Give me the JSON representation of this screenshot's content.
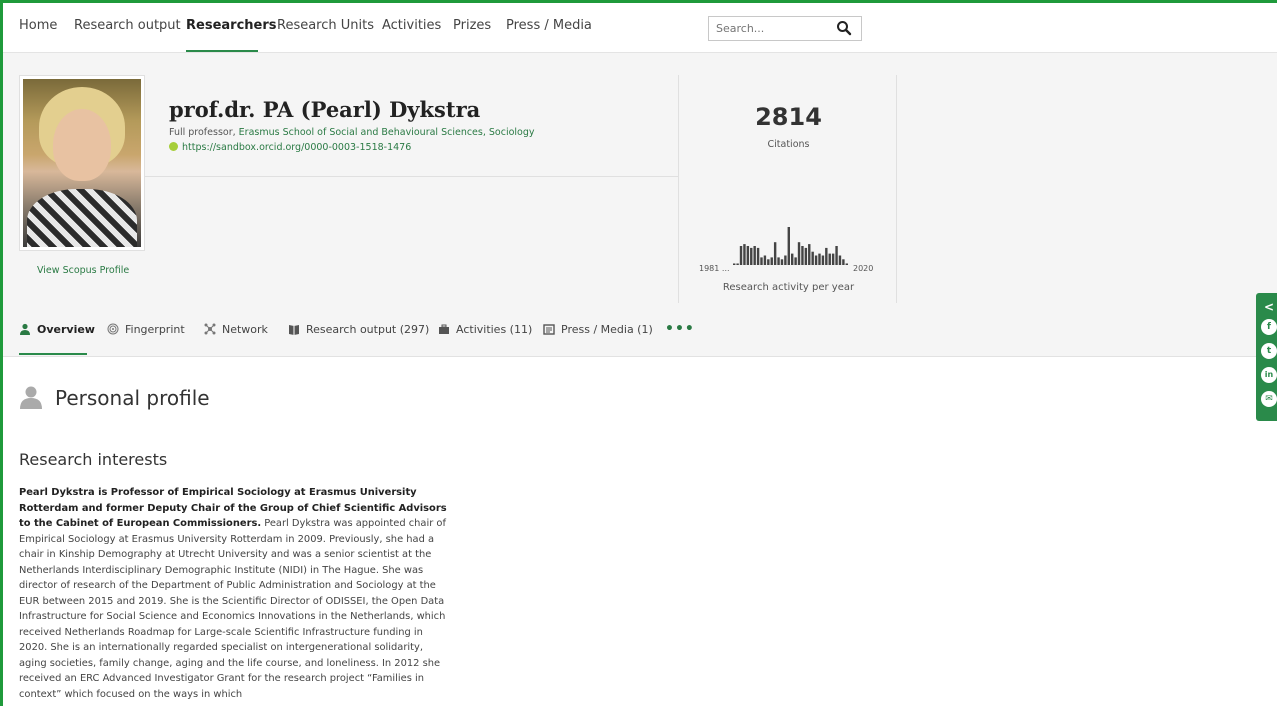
{
  "nav": {
    "items": [
      "Home",
      "Research output",
      "Researchers",
      "Research Units",
      "Activities",
      "Prizes",
      "Press / Media"
    ],
    "active_index": 2,
    "search_placeholder": "Search..."
  },
  "profile": {
    "name": "prof.dr. PA (Pearl) Dykstra",
    "position_prefix": "Full professor, ",
    "position_link": "Erasmus School of Social and Behavioural Sciences, Sociology",
    "orcid": "https://sandbox.orcid.org/0000-0003-1518-1476",
    "scopus_link": "View Scopus Profile"
  },
  "stats": {
    "citations": "2814",
    "citations_label": "Citations",
    "activity_start": "1981 ...",
    "activity_end": "2020",
    "activity_label": "Research activity per year",
    "activity_bars": [
      0.04,
      0.04,
      0.5,
      0.55,
      0.5,
      0.45,
      0.5,
      0.45,
      0.2,
      0.25,
      0.15,
      0.2,
      0.6,
      0.2,
      0.15,
      0.25,
      1.0,
      0.3,
      0.2,
      0.6,
      0.5,
      0.45,
      0.55,
      0.35,
      0.25,
      0.3,
      0.25,
      0.45,
      0.3,
      0.3,
      0.5,
      0.25,
      0.15,
      0.04
    ]
  },
  "tabs": [
    {
      "label": "Overview",
      "icon": "person-icon"
    },
    {
      "label": "Fingerprint",
      "icon": "fingerprint-icon"
    },
    {
      "label": "Network",
      "icon": "network-icon"
    },
    {
      "label": "Research output (297)",
      "icon": "book-icon"
    },
    {
      "label": "Activities (11)",
      "icon": "briefcase-icon"
    },
    {
      "label": "Press / Media (1)",
      "icon": "newspaper-icon"
    }
  ],
  "more_label": "•••",
  "content": {
    "section_title": "Personal profile",
    "sub_title": "Research interests",
    "bio_bold": "Pearl Dykstra is Professor of Empirical Sociology at Erasmus University Rotterdam and former Deputy Chair of the Group of Chief Scientific Advisors to the Cabinet of European Commissioners.",
    "bio_text": " Pearl Dykstra was appointed chair of Empirical Sociology at Erasmus University Rotterdam in 2009. Previously, she had a chair in Kinship Demography at Utrecht University and was a senior scientist at the Netherlands Interdisciplinary Demographic Institute (NIDI) in The Hague. She was director of research of the Department of Public Administration and Sociology at the EUR between 2015 and 2019. She is the Scientific Director of ODISSEI, the Open Data Infrastructure for Social Science and Economics Innovations in the Netherlands, which received Netherlands Roadmap for Large-scale Scientific Infrastructure funding in 2020. She is an internationally regarded specialist on intergenerational solidarity, aging societies, family change, aging and the life course, and loneliness. In 2012 she received an ERC Advanced Investigator Grant for the research project “Families in context” which focused on the ways in which"
  },
  "share": {
    "buttons": [
      {
        "icon": "share-icon",
        "glyph": "<"
      },
      {
        "icon": "facebook-icon",
        "glyph": "f"
      },
      {
        "icon": "twitter-icon",
        "glyph": "t"
      },
      {
        "icon": "linkedin-icon",
        "glyph": "in"
      },
      {
        "icon": "email-icon",
        "glyph": "✉"
      }
    ]
  },
  "colors": {
    "accent": "#2a8a4a",
    "frame": "#1f9a3b"
  }
}
